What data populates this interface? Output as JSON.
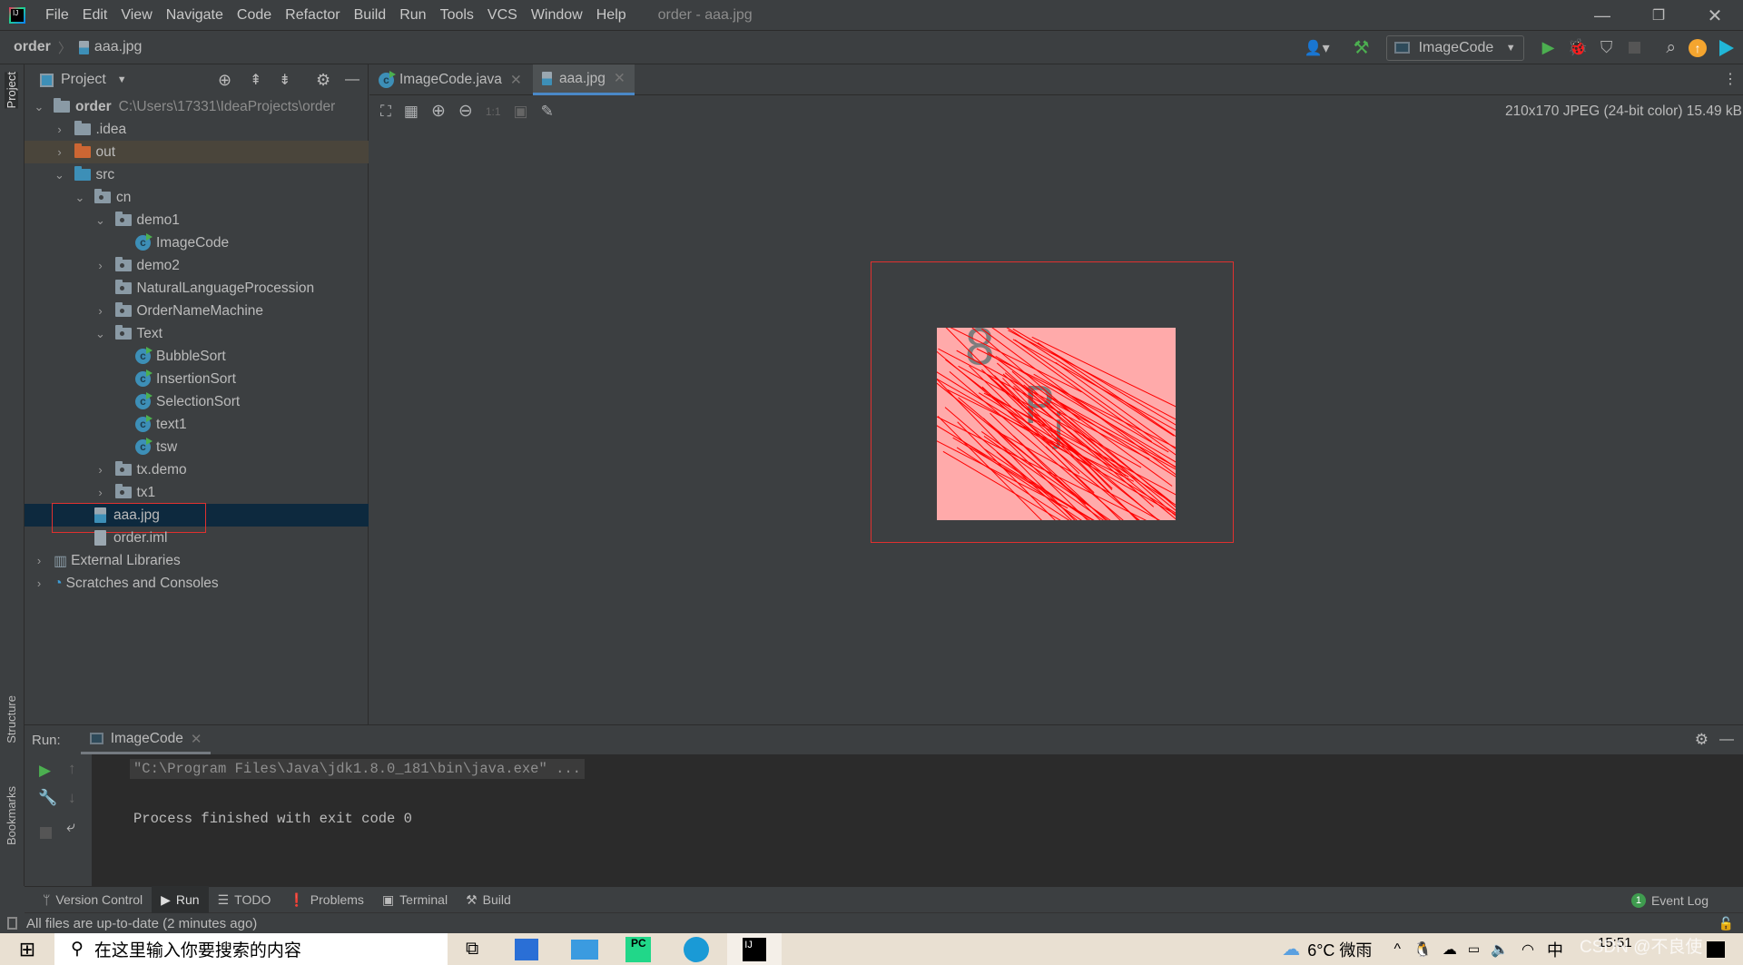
{
  "window": {
    "title": "order - aaa.jpg",
    "menu": [
      "File",
      "Edit",
      "View",
      "Navigate",
      "Code",
      "Refactor",
      "Build",
      "Run",
      "Tools",
      "VCS",
      "Window",
      "Help"
    ]
  },
  "breadcrumb": {
    "project": "order",
    "file": "aaa.jpg"
  },
  "toolbar": {
    "run_config": "ImageCode"
  },
  "left_strip": {
    "project": "Project",
    "structure": "Structure",
    "bookmarks": "Bookmarks"
  },
  "project_panel": {
    "title": "Project",
    "root_path": "C:\\Users\\17331\\IdeaProjects\\order",
    "tree": [
      {
        "label": "order",
        "depth": 0,
        "expander": "open",
        "icon": "module-folder"
      },
      {
        "label": ".idea",
        "depth": 1,
        "expander": "closed",
        "icon": "folder"
      },
      {
        "label": "out",
        "depth": 1,
        "expander": "closed",
        "icon": "folder-excluded"
      },
      {
        "label": "src",
        "depth": 1,
        "expander": "open",
        "icon": "source-folder"
      },
      {
        "label": "cn",
        "depth": 2,
        "expander": "open",
        "icon": "package"
      },
      {
        "label": "demo1",
        "depth": 3,
        "expander": "open",
        "icon": "package"
      },
      {
        "label": "ImageCode",
        "depth": 4,
        "expander": "none",
        "icon": "class"
      },
      {
        "label": "demo2",
        "depth": 3,
        "expander": "closed",
        "icon": "package"
      },
      {
        "label": "NaturalLanguageProcession",
        "depth": 3,
        "expander": "none",
        "icon": "package"
      },
      {
        "label": "OrderNameMachine",
        "depth": 3,
        "expander": "closed",
        "icon": "package"
      },
      {
        "label": "Text",
        "depth": 3,
        "expander": "open",
        "icon": "package"
      },
      {
        "label": "BubbleSort",
        "depth": 4,
        "expander": "none",
        "icon": "class"
      },
      {
        "label": "InsertionSort",
        "depth": 4,
        "expander": "none",
        "icon": "class"
      },
      {
        "label": "SelectionSort",
        "depth": 4,
        "expander": "none",
        "icon": "class"
      },
      {
        "label": "text1",
        "depth": 4,
        "expander": "none",
        "icon": "class"
      },
      {
        "label": "tsw",
        "depth": 4,
        "expander": "none",
        "icon": "class"
      },
      {
        "label": "tx.demo",
        "depth": 3,
        "expander": "closed",
        "icon": "package"
      },
      {
        "label": "tx1",
        "depth": 3,
        "expander": "closed",
        "icon": "package"
      },
      {
        "label": "aaa.jpg",
        "depth": 2,
        "expander": "none",
        "icon": "image-file",
        "selected": true
      },
      {
        "label": "order.iml",
        "depth": 2,
        "expander": "none",
        "icon": "iml-file"
      },
      {
        "label": "External Libraries",
        "depth": 0,
        "expander": "closed",
        "icon": "libraries"
      },
      {
        "label": "Scratches and Consoles",
        "depth": 0,
        "expander": "closed",
        "icon": "scratches"
      }
    ]
  },
  "editor": {
    "tabs": [
      {
        "label": "ImageCode.java",
        "active": false
      },
      {
        "label": "aaa.jpg",
        "active": true
      }
    ],
    "image_info": "210x170 JPEG (24-bit color) 15.49 kB",
    "zoom_actual": "1:1",
    "captcha_chars": [
      "8",
      "P",
      "j"
    ],
    "image_bg": "#ffaaaa",
    "line_color": "#ff0000"
  },
  "run": {
    "label": "Run:",
    "tab": "ImageCode",
    "lines": [
      "\"C:\\Program Files\\Java\\jdk1.8.0_181\\bin\\java.exe\" ...",
      "",
      "Process finished with exit code 0"
    ]
  },
  "tool_windows": [
    "Version Control",
    "Run",
    "TODO",
    "Problems",
    "Terminal",
    "Build"
  ],
  "event_log": {
    "count": "1",
    "label": "Event Log"
  },
  "status": {
    "text": "All files are up-to-date (2 minutes ago)"
  },
  "taskbar": {
    "search_placeholder": "在这里输入你要搜索的内容",
    "weather": "6°C 微雨",
    "ime": "中",
    "time": "15:51",
    "watermark": "CSDN @不良使"
  }
}
